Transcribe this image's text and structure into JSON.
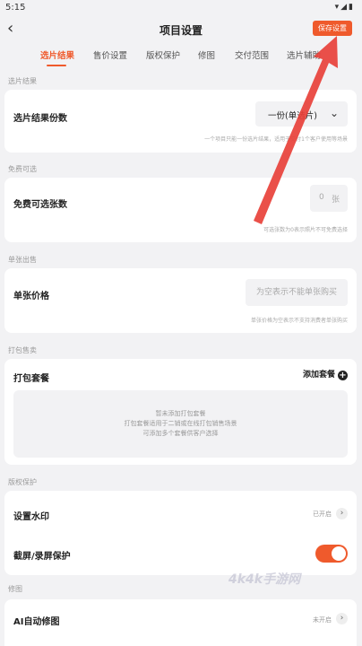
{
  "status_bar": {
    "time": "5:15",
    "icons": [
      "wifi-icon",
      "signal-icon",
      "battery-icon"
    ]
  },
  "header": {
    "title": "项目设置",
    "save_label": "保存设置"
  },
  "tabs": [
    {
      "label": "选片结果",
      "active": true
    },
    {
      "label": "售价设置",
      "active": false
    },
    {
      "label": "版权保护",
      "active": false
    },
    {
      "label": "修图",
      "active": false
    },
    {
      "label": "交付范围",
      "active": false
    },
    {
      "label": "选片辅助",
      "active": false
    }
  ],
  "sections": {
    "result": {
      "label": "选片结果",
      "row_title": "选片结果份数",
      "dropdown_value": "一份(单选片)",
      "hint": "一个项目只能一份选片结果，适用于交付1个客户使用等场景"
    },
    "free": {
      "label": "免费可选",
      "row_title": "免费可选张数",
      "count": "0",
      "unit": "张",
      "hint": "可选张数为0表示照片不可免费选择"
    },
    "single": {
      "label": "单张出售",
      "row_title": "单张价格",
      "placeholder": "为空表示不能单张购买",
      "hint": "单张价格为空表示不支持消费者单张购买"
    },
    "package": {
      "label": "打包售卖",
      "row_title": "打包套餐",
      "add_label": "添加套餐",
      "empty_lines": [
        "暂未添加打包套餐",
        "打包套餐适用于二销或在线打包销售场景",
        "可添加多个套餐供客户选择"
      ]
    },
    "copyright": {
      "label": "版权保护",
      "watermark_title": "设置水印",
      "watermark_status": "已开启",
      "screenshot_title": "截屏/录屏保护",
      "screenshot_enabled": true
    },
    "retouch": {
      "label": "修图",
      "ai_title": "AI自动修图",
      "ai_status": "未开启"
    }
  },
  "watermark_text": "4k4k手游网",
  "colors": {
    "accent": "#ef5a2c",
    "background": "#f2f2f4",
    "card": "#ffffff",
    "arrow": "#e8413a"
  }
}
